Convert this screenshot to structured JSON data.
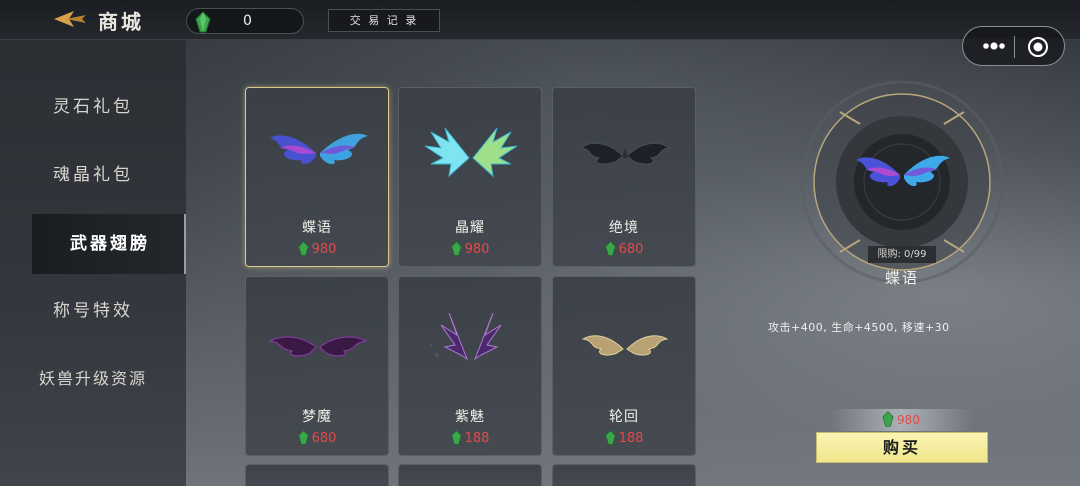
{
  "header": {
    "title": "商城",
    "currency_amount": "0",
    "trade_record_label": "交 易 记 录"
  },
  "sidebar": {
    "items": [
      {
        "label": "灵石礼包"
      },
      {
        "label": "魂晶礼包"
      },
      {
        "label": "武器翅膀"
      },
      {
        "label": "称号特效"
      },
      {
        "label": "妖兽升级资源"
      }
    ],
    "active_index": 2
  },
  "items": [
    {
      "name": "蝶语",
      "price": "980",
      "color": "#5b6cf0"
    },
    {
      "name": "晶耀",
      "price": "980",
      "color": "#7fe4f2"
    },
    {
      "name": "绝境",
      "price": "680",
      "color": "#2a2f36"
    },
    {
      "name": "梦魔",
      "price": "680",
      "color": "#6b2a7a"
    },
    {
      "name": "紫魅",
      "price": "188",
      "color": "#8a4fb0"
    },
    {
      "name": "轮回",
      "price": "188",
      "color": "#c9b27a"
    }
  ],
  "detail": {
    "limit": "限购: 0/99",
    "name": "蝶语",
    "stats": "攻击+400, 生命+4500, 移速+30",
    "price": "980",
    "buy_label": "购买"
  },
  "colors": {
    "price": "#e24a4a",
    "gem": "#3aa84a",
    "buy_button": "#f4ec9c",
    "selected_border": "#d9c98a"
  },
  "icons": {
    "back": "back-arrow-icon",
    "gem": "jade-gem-icon",
    "more": "more-dots-icon",
    "close": "target-close-icon"
  }
}
